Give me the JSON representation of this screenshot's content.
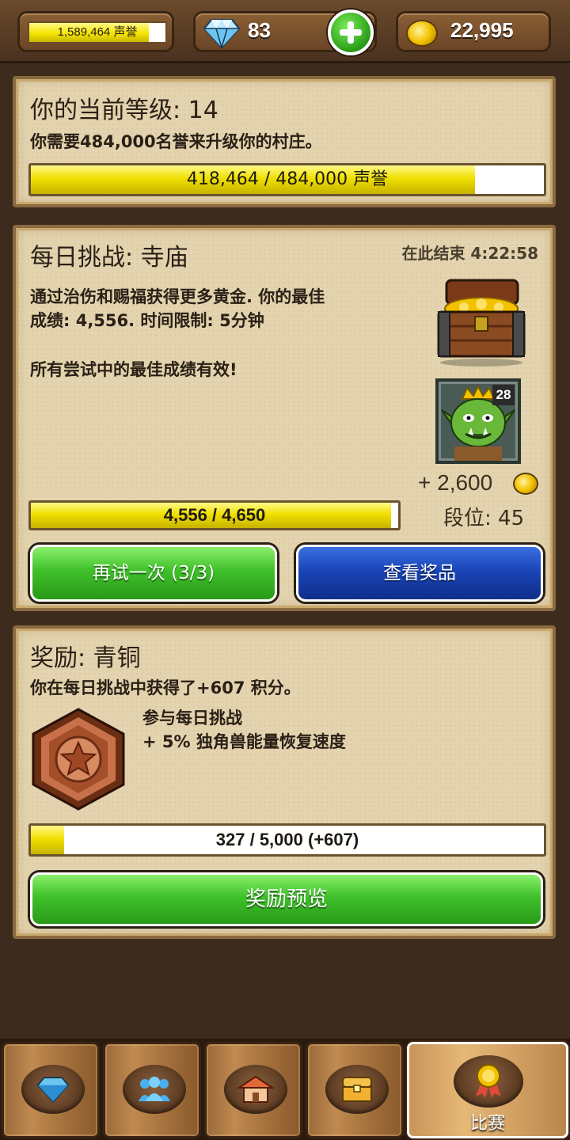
{
  "topbar": {
    "fame_text": "1,589,464 声誉",
    "fame_progress": 0.88,
    "gems": "83",
    "gold": "22,995"
  },
  "level_panel": {
    "title": "你的当前等级: 14",
    "description": "你需要484,000名誉来升级你的村庄。",
    "progress_text": "418,464 / 484,000 声誉",
    "progress": 0.865
  },
  "challenge_panel": {
    "title": "每日挑战: 寺庙",
    "ends_in": "在此结束 4:22:58",
    "desc_line1": "通过治伤和赐福获得更多黄金. 你的最佳",
    "desc_line2": "成绩: 4,556. 时间限制: 5分钟",
    "note": "所有尝试中的最佳成绩有效!",
    "opponent_level": "28",
    "reward_gold": "+ 2,600",
    "rank": "段位: 45",
    "progress_text": "4,556 / 4,650",
    "progress": 0.98,
    "retry_button": "再试一次 (3/3)",
    "prizes_button": "查看奖品"
  },
  "reward_panel": {
    "title": "奖励: 青铜",
    "points_text": "你在每日挑战中获得了+607 积分。",
    "perk_line1": "参与每日挑战",
    "perk_line2": "+ 5% 独角兽能量恢复速度",
    "progress_text": "327 / 5,000 (+607)",
    "progress": 0.065,
    "preview_button": "奖励预览"
  },
  "nav": {
    "tabs": [
      {
        "icon": "gem-icon",
        "label": ""
      },
      {
        "icon": "people-icon",
        "label": ""
      },
      {
        "icon": "village-icon",
        "label": ""
      },
      {
        "icon": "chest-icon",
        "label": ""
      },
      {
        "icon": "medal-icon",
        "label": "比赛",
        "active": true
      }
    ]
  },
  "colors": {
    "bar_yellow": "#f0e000",
    "button_green": "#3fc02a",
    "button_blue": "#1a45b8",
    "panel_bg": "#e3d3ae"
  }
}
